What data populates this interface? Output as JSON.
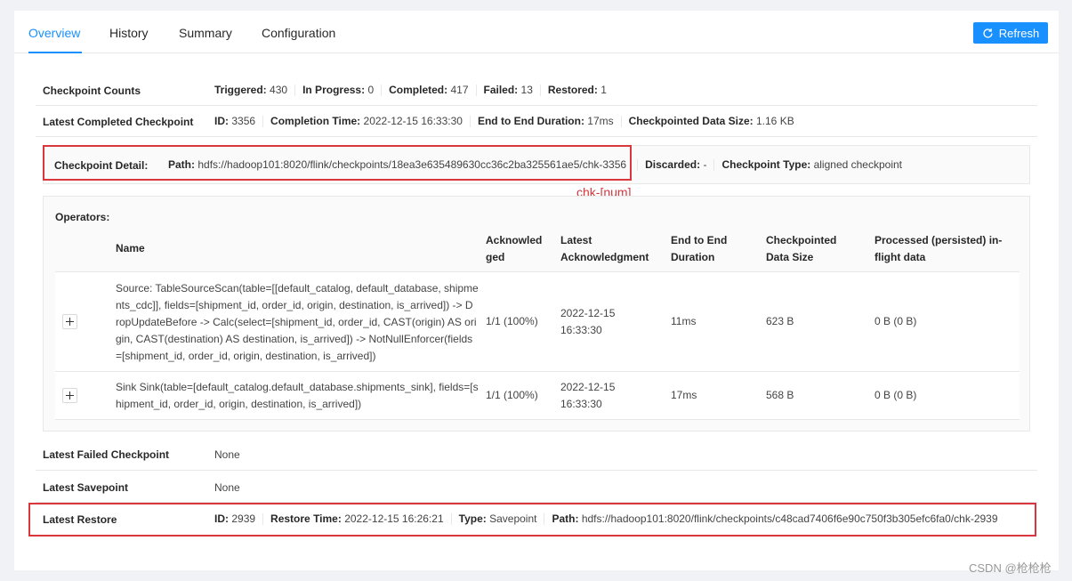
{
  "tabs": [
    {
      "label": "Overview",
      "active": true
    },
    {
      "label": "History"
    },
    {
      "label": "Summary"
    },
    {
      "label": "Configuration"
    }
  ],
  "refresh_label": "Refresh",
  "counts": {
    "label": "Checkpoint Counts",
    "items": [
      {
        "k": "Triggered:",
        "v": "430"
      },
      {
        "k": "In Progress:",
        "v": "0"
      },
      {
        "k": "Completed:",
        "v": "417"
      },
      {
        "k": "Failed:",
        "v": "13"
      },
      {
        "k": "Restored:",
        "v": "1"
      }
    ]
  },
  "latest_completed": {
    "label": "Latest Completed Checkpoint",
    "items": [
      {
        "k": "ID:",
        "v": "3356"
      },
      {
        "k": "Completion Time:",
        "v": "2022-12-15 16:33:30"
      },
      {
        "k": "End to End Duration:",
        "v": "17ms"
      },
      {
        "k": "Checkpointed Data Size:",
        "v": "1.16 KB"
      }
    ]
  },
  "detail": {
    "label": "Checkpoint Detail:",
    "path_k": "Path:",
    "path_v": "hdfs://hadoop101:8020/flink/checkpoints/18ea3e635489630cc36c2ba325561ae5/chk-3356",
    "discarded_k": "Discarded:",
    "discarded_v": "-",
    "type_k": "Checkpoint Type:",
    "type_v": "aligned checkpoint"
  },
  "annotation": "chk-[num]",
  "operators": {
    "title": "Operators:",
    "headers": {
      "name": "Name",
      "ack_1": "Acknowled",
      "ack_2": "ged",
      "latest_1": "Latest",
      "latest_2": "Acknowledgment",
      "e2e_1": "End to End",
      "e2e_2": "Duration",
      "size_1": "Checkpointed",
      "size_2": "Data Size",
      "proc_1": "Processed (persisted) in-",
      "proc_2": "flight data"
    },
    "rows": [
      {
        "name_lines": [
          "Source: TableSourceScan(table=[[default_catalog, default_database, shipme",
          "nts_cdc]], fields=[shipment_id, order_id, origin, destination, is_arrived]) -> D",
          "ropUpdateBefore -> Calc(select=[shipment_id, order_id, CAST(origin) AS ori",
          "gin, CAST(destination) AS destination, is_arrived]) -> NotNullEnforcer(fields",
          "=[shipment_id, order_id, origin, destination, is_arrived])"
        ],
        "ack": "1/1 (100%)",
        "latest_date": "2022-12-15",
        "latest_time": "16:33:30",
        "e2e": "11ms",
        "size": "623 B",
        "processed": "0 B (0 B)"
      },
      {
        "name_lines": [
          "Sink Sink(table=[default_catalog.default_database.shipments_sink], fields=[s",
          "hipment_id, order_id, origin, destination, is_arrived])"
        ],
        "ack": "1/1 (100%)",
        "latest_date": "2022-12-15",
        "latest_time": "16:33:30",
        "e2e": "17ms",
        "size": "568 B",
        "processed": "0 B (0 B)"
      }
    ]
  },
  "latest_failed": {
    "label": "Latest Failed Checkpoint",
    "value": "None"
  },
  "latest_savepoint": {
    "label": "Latest Savepoint",
    "value": "None"
  },
  "latest_restore": {
    "label": "Latest Restore",
    "items": [
      {
        "k": "ID:",
        "v": "2939"
      },
      {
        "k": "Restore Time:",
        "v": "2022-12-15 16:26:21"
      },
      {
        "k": "Type:",
        "v": "Savepoint"
      },
      {
        "k": "Path:",
        "v": "hdfs://hadoop101:8020/flink/checkpoints/c48cad7406f6e90c750f3b305efc6fa0/chk-2939"
      }
    ]
  },
  "watermark": "CSDN @枪枪枪",
  "colors": {
    "accent": "#1890ff",
    "highlight": "#d9363e"
  }
}
